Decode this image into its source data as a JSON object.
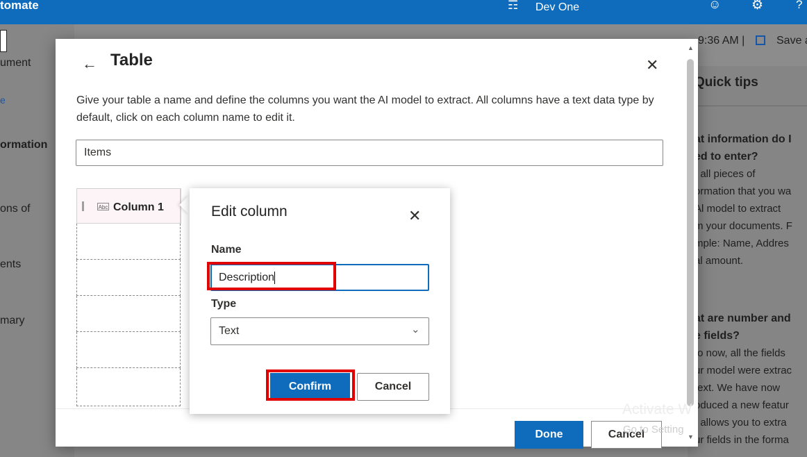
{
  "topbar": {
    "app_title": "tomate",
    "environment_icon": "environment-icon",
    "environment_name": "Dev One",
    "icons": [
      "smiley-icon",
      "gear-icon",
      "help-icon"
    ],
    "help_glyph": "?",
    "accent_color": "#0f6cbd"
  },
  "background": {
    "sidebar_items": [
      "ument",
      "e",
      "ormation",
      "ons of",
      "ents",
      "mary"
    ],
    "toolbar_text": "9:36 AM |",
    "save_label": "Save a",
    "quick_tips_title": "Quick tips",
    "tip1": {
      "question": [
        "at information do I",
        "ed to enter?"
      ],
      "lines": [
        ": all pieces of",
        "ormation that you wa",
        "Al model to extract",
        "m your documents. F",
        "mple: Name, Addres",
        "al amount."
      ]
    },
    "tip2": {
      "question": [
        "at are number and",
        "e fields?"
      ],
      "lines": [
        "to now, all the fields",
        "ur model were extrac",
        "text. We have now",
        "oduced a new featur",
        "t allows you to extra",
        "ur fields in the forma"
      ]
    },
    "watermark_title": "Activate W",
    "watermark_subtitle": "Go to Setting"
  },
  "dialog": {
    "title": "Table",
    "description": "Give your table a name and define the columns you want the AI model to extract. All columns have a text data type by default, click on each column name to edit it.",
    "table_name_value": "Items",
    "column_header": "Column 1",
    "column_type_icon": "Abc",
    "done_label": "Done",
    "cancel_label": "Cancel"
  },
  "edit_column": {
    "title": "Edit column",
    "name_label": "Name",
    "name_value": "Description",
    "type_label": "Type",
    "type_value": "Text",
    "confirm_label": "Confirm",
    "cancel_label": "Cancel"
  },
  "highlight_color": "#e00000"
}
